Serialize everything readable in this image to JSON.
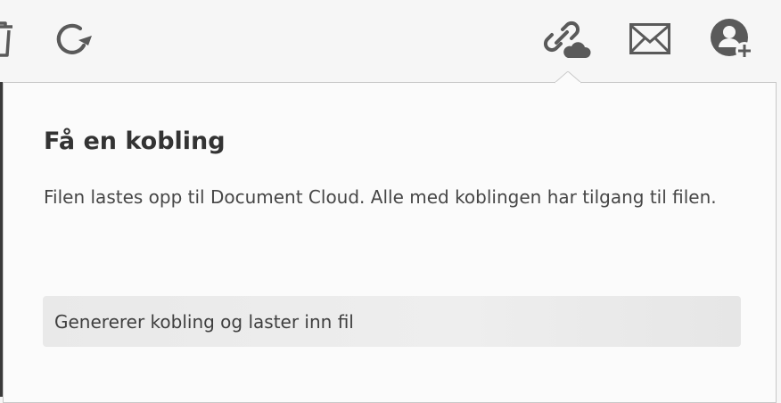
{
  "toolbar": {
    "icons": [
      "delete-icon",
      "rotate-icon",
      "link-cloud-icon",
      "email-icon",
      "add-person-icon"
    ]
  },
  "panel": {
    "title": "Få en kobling",
    "description": "Filen lastes opp til Document Cloud. Alle med koblingen har tilgang til filen.",
    "progress_text": "Genererer kobling og laster inn fil"
  },
  "colors": {
    "icon": "#5a5a5a",
    "panel_bg": "#fbfbfb",
    "field_bg": "#eaeaea"
  }
}
